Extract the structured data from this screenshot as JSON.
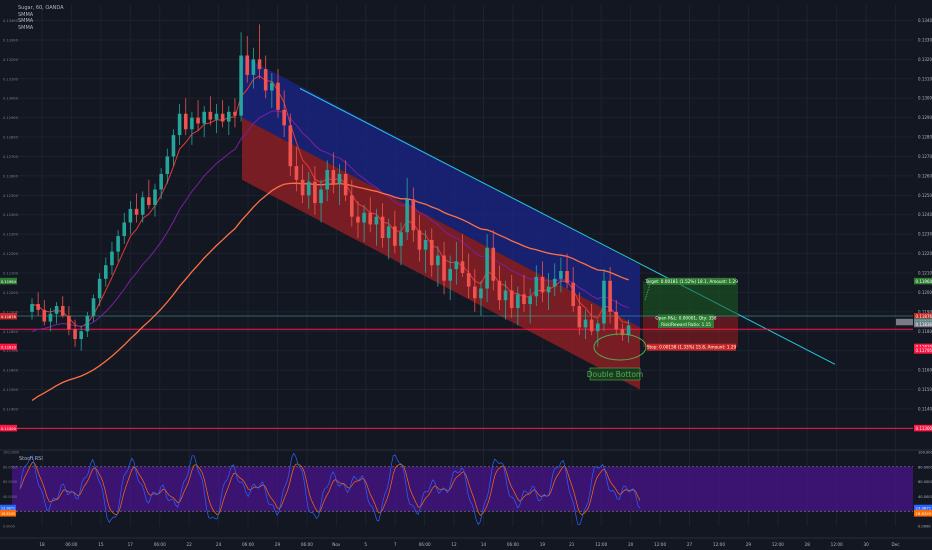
{
  "header": {
    "symbol_line": "Sugar, 60, OANDA",
    "indicators": [
      "SMMA",
      "SMMA",
      "SMMA"
    ]
  },
  "stoch": {
    "label": "Stoch RSI"
  },
  "chart_data": {
    "type": "candlestick",
    "symbol": "Sugar",
    "interval": "60",
    "source": "OANDA",
    "price_axis": {
      "range": [
        0.1124,
        0.1348
      ],
      "ticks": [
        "0.13400",
        "0.13300",
        "0.13200",
        "0.13100",
        "0.13000",
        "0.12900",
        "0.12800",
        "0.12700",
        "0.12600",
        "0.12500",
        "0.12400",
        "0.12300",
        "0.12200",
        "0.12100",
        "0.12000",
        "0.11900",
        "0.11800",
        "0.11700",
        "0.11600",
        "0.11500",
        "0.11400",
        "0.11300"
      ]
    },
    "time_axis": {
      "labels": [
        "18",
        "06:00",
        "15",
        "17",
        "06:00",
        "22",
        "24",
        "06:00",
        "29",
        "06:00",
        "Nov",
        "5",
        "7",
        "06:00",
        "12",
        "14",
        "06:00",
        "19",
        "21",
        "12:00",
        "20",
        "12:00",
        "27",
        "12:00",
        "29",
        "12:00",
        "28",
        "12:00",
        "30",
        "Dec"
      ]
    },
    "candles": [
      [
        0.119,
        0.1197,
        0.1186,
        0.1194
      ],
      [
        0.1194,
        0.12,
        0.1188,
        0.1191
      ],
      [
        0.1191,
        0.1196,
        0.1183,
        0.1185
      ],
      [
        0.1185,
        0.1192,
        0.118,
        0.1189
      ],
      [
        0.1189,
        0.1195,
        0.1184,
        0.1193
      ],
      [
        0.1193,
        0.1198,
        0.1187,
        0.1188
      ],
      [
        0.1188,
        0.1193,
        0.1178,
        0.1181
      ],
      [
        0.1181,
        0.1186,
        0.1172,
        0.1176
      ],
      [
        0.1176,
        0.1183,
        0.117,
        0.118
      ],
      [
        0.118,
        0.119,
        0.1177,
        0.1188
      ],
      [
        0.1188,
        0.1199,
        0.1185,
        0.1197
      ],
      [
        0.1197,
        0.121,
        0.1193,
        0.1207
      ],
      [
        0.1207,
        0.1218,
        0.1203,
        0.1214
      ],
      [
        0.1214,
        0.1226,
        0.1209,
        0.1221
      ],
      [
        0.1221,
        0.1232,
        0.1216,
        0.1229
      ],
      [
        0.1229,
        0.1241,
        0.1225,
        0.1236
      ],
      [
        0.1236,
        0.1247,
        0.123,
        0.1243
      ],
      [
        0.1243,
        0.1251,
        0.1236,
        0.124
      ],
      [
        0.124,
        0.1252,
        0.1236,
        0.1249
      ],
      [
        0.1249,
        0.1258,
        0.1243,
        0.1245
      ],
      [
        0.1245,
        0.1256,
        0.1239,
        0.1253
      ],
      [
        0.1253,
        0.1264,
        0.1248,
        0.1261
      ],
      [
        0.1261,
        0.1274,
        0.1256,
        0.127
      ],
      [
        0.127,
        0.1284,
        0.1265,
        0.1281
      ],
      [
        0.1281,
        0.1297,
        0.1276,
        0.1292
      ],
      [
        0.1292,
        0.13,
        0.1281,
        0.1284
      ],
      [
        0.1284,
        0.1293,
        0.1276,
        0.129
      ],
      [
        0.129,
        0.1299,
        0.1283,
        0.1287
      ],
      [
        0.1287,
        0.1296,
        0.128,
        0.1293
      ],
      [
        0.1293,
        0.1301,
        0.1286,
        0.1289
      ],
      [
        0.1289,
        0.1297,
        0.1282,
        0.1292
      ],
      [
        0.1292,
        0.1299,
        0.1285,
        0.1288
      ],
      [
        0.1288,
        0.1296,
        0.1281,
        0.1293
      ],
      [
        0.1293,
        0.13,
        0.1285,
        0.1291
      ],
      [
        0.1291,
        0.1334,
        0.1288,
        0.1322
      ],
      [
        0.1322,
        0.1332,
        0.1308,
        0.1312
      ],
      [
        0.1312,
        0.1326,
        0.1305,
        0.132
      ],
      [
        0.132,
        0.1338,
        0.131,
        0.1315
      ],
      [
        0.1315,
        0.1322,
        0.13,
        0.1304
      ],
      [
        0.1304,
        0.1313,
        0.1295,
        0.1308
      ],
      [
        0.1308,
        0.1315,
        0.129,
        0.1294
      ],
      [
        0.1294,
        0.1304,
        0.128,
        0.1286
      ],
      [
        0.1286,
        0.1292,
        0.126,
        0.1265
      ],
      [
        0.1265,
        0.1275,
        0.1252,
        0.1258
      ],
      [
        0.1258,
        0.1266,
        0.1246,
        0.125
      ],
      [
        0.125,
        0.1262,
        0.1243,
        0.1257
      ],
      [
        0.1257,
        0.1265,
        0.124,
        0.1246
      ],
      [
        0.1246,
        0.1258,
        0.1236,
        0.1253
      ],
      [
        0.1253,
        0.1268,
        0.1247,
        0.1263
      ],
      [
        0.1263,
        0.1272,
        0.1251,
        0.1256
      ],
      [
        0.1256,
        0.1266,
        0.1245,
        0.1261
      ],
      [
        0.1261,
        0.1268,
        0.1247,
        0.125
      ],
      [
        0.125,
        0.1258,
        0.1234,
        0.1239
      ],
      [
        0.1239,
        0.1247,
        0.1228,
        0.1236
      ],
      [
        0.1236,
        0.1245,
        0.1226,
        0.1241
      ],
      [
        0.1241,
        0.1249,
        0.1231,
        0.1235
      ],
      [
        0.1235,
        0.1243,
        0.1224,
        0.1239
      ],
      [
        0.1239,
        0.1246,
        0.1223,
        0.1228
      ],
      [
        0.1228,
        0.1238,
        0.1217,
        0.1234
      ],
      [
        0.1234,
        0.1242,
        0.122,
        0.1224
      ],
      [
        0.1224,
        0.1236,
        0.1214,
        0.1231
      ],
      [
        0.1231,
        0.1259,
        0.1227,
        0.1248
      ],
      [
        0.1248,
        0.1254,
        0.1226,
        0.1232
      ],
      [
        0.1232,
        0.124,
        0.1216,
        0.1222
      ],
      [
        0.1222,
        0.1232,
        0.121,
        0.1227
      ],
      [
        0.1227,
        0.1233,
        0.1208,
        0.1214
      ],
      [
        0.1214,
        0.1224,
        0.1203,
        0.1219
      ],
      [
        0.1219,
        0.1226,
        0.1199,
        0.1206
      ],
      [
        0.1206,
        0.1219,
        0.1196,
        0.1212
      ],
      [
        0.1212,
        0.1226,
        0.1204,
        0.1216
      ],
      [
        0.1216,
        0.123,
        0.1208,
        0.121
      ],
      [
        0.121,
        0.122,
        0.1197,
        0.1203
      ],
      [
        0.1203,
        0.1212,
        0.119,
        0.1197
      ],
      [
        0.1197,
        0.1206,
        0.1188,
        0.1202
      ],
      [
        0.1202,
        0.123,
        0.1195,
        0.1223
      ],
      [
        0.1223,
        0.1232,
        0.1201,
        0.1206
      ],
      [
        0.1206,
        0.1214,
        0.1191,
        0.1196
      ],
      [
        0.1196,
        0.1206,
        0.1186,
        0.1201
      ],
      [
        0.1201,
        0.1209,
        0.1187,
        0.1192
      ],
      [
        0.1192,
        0.1203,
        0.1183,
        0.1199
      ],
      [
        0.1199,
        0.1209,
        0.119,
        0.1194
      ],
      [
        0.1194,
        0.1202,
        0.1184,
        0.1198
      ],
      [
        0.1198,
        0.1214,
        0.1193,
        0.1208
      ],
      [
        0.1208,
        0.1216,
        0.1195,
        0.12
      ],
      [
        0.12,
        0.121,
        0.1191,
        0.1203
      ],
      [
        0.1203,
        0.1215,
        0.1198,
        0.1207
      ],
      [
        0.1207,
        0.1218,
        0.12,
        0.1211
      ],
      [
        0.1211,
        0.122,
        0.1202,
        0.1205
      ],
      [
        0.1205,
        0.1213,
        0.119,
        0.1193
      ],
      [
        0.1193,
        0.12,
        0.1178,
        0.1182
      ],
      [
        0.1182,
        0.1191,
        0.1176,
        0.1186
      ],
      [
        0.1186,
        0.1194,
        0.1178,
        0.118
      ],
      [
        0.118,
        0.1186,
        0.1172,
        0.1184
      ],
      [
        0.1184,
        0.1212,
        0.118,
        0.1206
      ],
      [
        0.1206,
        0.1213,
        0.1184,
        0.119
      ],
      [
        0.119,
        0.1196,
        0.1178,
        0.1181
      ],
      [
        0.1181,
        0.1184,
        0.1175,
        0.1178
      ],
      [
        0.1178,
        0.1186,
        0.1174,
        0.1183
      ]
    ],
    "moving_averages": [
      {
        "name": "SMMA",
        "color": "#e53935",
        "period": "fast"
      },
      {
        "name": "SMMA",
        "color": "#7b1fa2",
        "period": "medium"
      },
      {
        "name": "SMMA",
        "color": "#ff7043",
        "period": "slow"
      }
    ],
    "channel": {
      "upper_color": "#1a237e",
      "lower_color": "#8b1e24",
      "trendline_color": "#26c6da"
    },
    "horizontal_lines": [
      {
        "price": 0.1181,
        "color": "#ff1744"
      },
      {
        "price": 0.113,
        "color": "#ff1744"
      }
    ],
    "position": {
      "target_label": "Target: 0.00181 (1.52%) 18.1, Amount: 1.29",
      "open_label": "Open P&L: 0.00001, Qty: 358",
      "rr_label": "Risk/Reward Ratio: 1.15",
      "stop_label": "Stop: 0.00158 (1.33%) 15.8, Amount: 1.29",
      "profit_color": "#1b5e20",
      "loss_color": "#b71c1c"
    },
    "annotation": {
      "text": "Double Bottom",
      "color": "#4caf50"
    },
    "price_labels": [
      "0.11964",
      "0.11876",
      "0.11846",
      "0.11836",
      "0.11810",
      "0.11795",
      "0.11300"
    ],
    "stoch_rsi": {
      "axis": [
        "100.0000",
        "80.0000",
        "60.0000",
        "40.0000",
        "20.0000",
        "0.0000"
      ],
      "k_color": "#2962ff",
      "d_color": "#ff6d00",
      "band_upper": 80,
      "band_lower": 20,
      "last_values": [
        "23.9871",
        "16.8345"
      ]
    }
  }
}
